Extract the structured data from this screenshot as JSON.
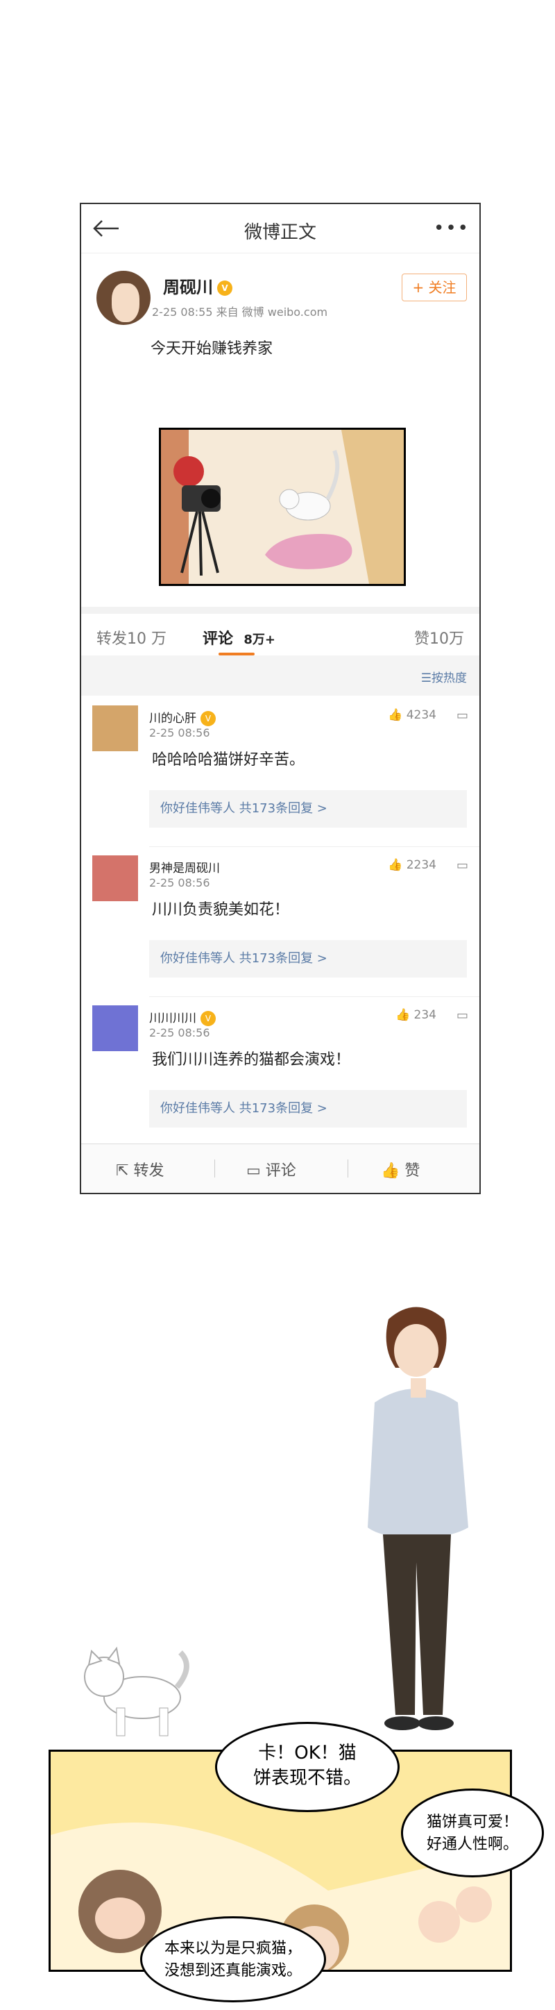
{
  "topbar": {
    "title": "微博正文"
  },
  "post": {
    "author": "周砚川",
    "meta": "2-25 08:55  来自 微博 weibo.com",
    "follow_label": "+ 关注",
    "text": "今天开始赚钱养家"
  },
  "tabs": {
    "repost": "转发10 万",
    "comment": "评论",
    "comment_count": "8万+",
    "likes": "赞10万"
  },
  "sort_label": "按热度",
  "comments": [
    {
      "name": "川的心肝",
      "time": "2-25 08:56",
      "likes": "4234",
      "text": "哈哈哈哈猫饼好辛苦。",
      "sub": "你好佳伟等人 共173条回复 >",
      "avatar_color": "#d4a56a",
      "verified": true
    },
    {
      "name": "男神是周砚川",
      "time": "2-25 08:56",
      "likes": "2234",
      "text": "川川负责貌美如花！",
      "sub": "你好佳伟等人 共173条回复 >",
      "avatar_color": "#d4736a",
      "verified": false
    },
    {
      "name": "川川川川",
      "time": "2-25 08:56",
      "likes": "234",
      "text": "我们川川连养的猫都会演戏！",
      "sub": "你好佳伟等人 共173条回复 >",
      "avatar_color": "#6f72d4",
      "verified": true
    }
  ],
  "bottombar": {
    "repost": "转发",
    "comment": "评论",
    "like": "赞"
  },
  "bubbles": {
    "b1": "卡！OK！猫\n饼表现不错。",
    "b2": "猫饼真可爱！\n好通人性啊。",
    "b3": "本来以为是只疯猫，\n没想到还真能演戏。"
  },
  "icons": [
    "back-arrow-icon",
    "more-dots-icon",
    "verified-badge-icon",
    "sort-icon",
    "thumb-up-icon",
    "reply-icon",
    "share-icon"
  ]
}
